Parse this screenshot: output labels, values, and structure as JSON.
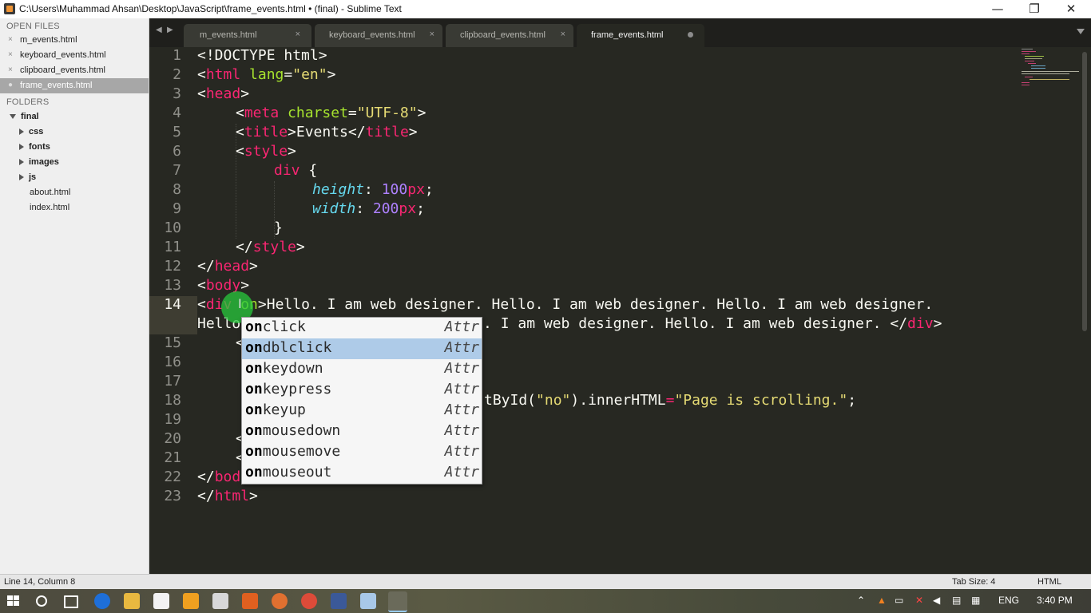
{
  "window": {
    "title": "C:\\Users\\Muhammad Ahsan\\Desktop\\JavaScript\\frame_events.html • (final) - Sublime Text",
    "minimize": "—",
    "maximize": "❐",
    "close": "✕"
  },
  "sidebar": {
    "open_files_heading": "OPEN FILES",
    "open_files": [
      {
        "name": "m_events.html",
        "close": "×"
      },
      {
        "name": "keyboard_events.html",
        "close": "×"
      },
      {
        "name": "clipboard_events.html",
        "close": "×"
      },
      {
        "name": "frame_events.html",
        "close": "●"
      }
    ],
    "folders_heading": "FOLDERS",
    "root": "final",
    "items": [
      "css",
      "fonts",
      "images",
      "js",
      "about.html",
      "index.html"
    ]
  },
  "tabs": {
    "nav_prev": "◀",
    "nav_next": "▶",
    "items": [
      {
        "label": "m_events.html",
        "close": "×"
      },
      {
        "label": "keyboard_events.html",
        "close": "×"
      },
      {
        "label": "clipboard_events.html",
        "close": "×"
      },
      {
        "label": "frame_events.html"
      }
    ]
  },
  "editor": {
    "line_numbers": [
      "1",
      "2",
      "3",
      "4",
      "5",
      "6",
      "7",
      "8",
      "9",
      "10",
      "11",
      "12",
      "13",
      "14",
      "15",
      "16",
      "17",
      "18",
      "19",
      "20",
      "21",
      "22",
      "23"
    ],
    "code": {
      "l1": "<!DOCTYPE html>",
      "l2": [
        "<",
        "html",
        " ",
        "lang",
        "=",
        "\"en\"",
        ">"
      ],
      "l3": [
        "<",
        "head",
        ">"
      ],
      "l4": [
        "<",
        "meta",
        " ",
        "charset",
        "=",
        "\"UTF-8\"",
        ">"
      ],
      "l5": [
        "<",
        "title",
        ">",
        "Events",
        "</",
        "title",
        ">"
      ],
      "l6": [
        "<",
        "style",
        ">"
      ],
      "l7": [
        "div",
        " {"
      ],
      "l8": [
        "height",
        ": ",
        "100",
        "px",
        ";"
      ],
      "l9": [
        "width",
        ": ",
        "200",
        "px",
        ";"
      ],
      "l10": "}",
      "l11": [
        "</",
        "style",
        ">"
      ],
      "l12": [
        "</",
        "head",
        ">"
      ],
      "l13": [
        "<",
        "body",
        ">"
      ],
      "l14a": [
        "<",
        "div",
        " ",
        "on",
        ">Hello. I am web designer. Hello. I am web designer. Hello. I am web designer."
      ],
      "l14b": [
        "Hello",
        "o. I am web designer. Hello. I am web designer. </",
        "div",
        ">"
      ],
      "l15": "<",
      "l18": [
        "tById(",
        "\"no\"",
        ").innerHTML",
        "=",
        "\"Page is scrolling.\"",
        ";"
      ],
      "l20": "<",
      "l21": "<",
      "l22": [
        "</",
        "body",
        ">"
      ],
      "l23": [
        "</",
        "html",
        ">"
      ]
    }
  },
  "autocomplete": {
    "prefix": "on",
    "items": [
      {
        "rest": "click",
        "kind": "Attr"
      },
      {
        "rest": "dblclick",
        "kind": "Attr"
      },
      {
        "rest": "keydown",
        "kind": "Attr"
      },
      {
        "rest": "keypress",
        "kind": "Attr"
      },
      {
        "rest": "keyup",
        "kind": "Attr"
      },
      {
        "rest": "mousedown",
        "kind": "Attr"
      },
      {
        "rest": "mousemove",
        "kind": "Attr"
      },
      {
        "rest": "mouseout",
        "kind": "Attr"
      }
    ],
    "selected_index": 1
  },
  "status": {
    "position": "Line 14, Column 8",
    "tab_size": "Tab Size: 4",
    "syntax": "HTML"
  },
  "taskbar": {
    "language": "ENG",
    "time": "3:40 PM"
  },
  "colors": {
    "tag": "#f92672",
    "attribute": "#a6e22e",
    "string": "#e6db74",
    "property": "#66d9ef",
    "number": "#ae81ff",
    "selection": "#aecbe8"
  }
}
